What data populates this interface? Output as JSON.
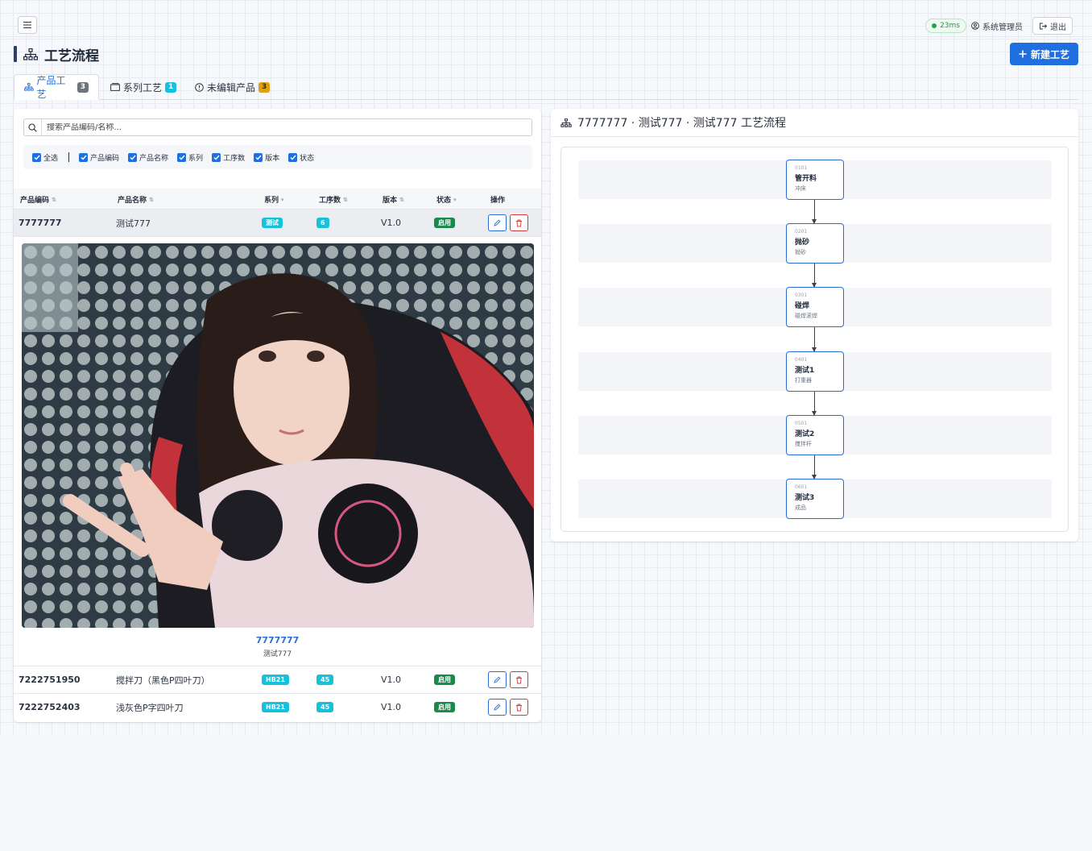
{
  "header": {
    "latency": "23ms",
    "user": "系统管理员",
    "logout": "退出"
  },
  "page": {
    "title": "工艺流程",
    "new_button": "新建工艺"
  },
  "tabs": [
    {
      "label": "产品工艺",
      "count": "3",
      "active": true
    },
    {
      "label": "系列工艺",
      "count": "1",
      "active": false
    },
    {
      "label": "未编辑产品",
      "count": "3",
      "active": false
    }
  ],
  "search": {
    "placeholder": "搜索产品编码/名称..."
  },
  "filters": [
    "全选",
    "产品编码",
    "产品名称",
    "系列",
    "工序数",
    "版本",
    "状态"
  ],
  "table": {
    "headers": [
      "产品编码",
      "产品名称",
      "系列",
      "工序数",
      "版本",
      "状态",
      "操作"
    ],
    "rows": [
      {
        "code": "7777777",
        "name": "测试777",
        "series": "测试",
        "steps": "6",
        "version": "V1.0",
        "status": "启用"
      },
      {
        "code": "7222751950",
        "name": "搅拌刀（黑色P四叶刀）",
        "series": "HB21",
        "steps": "45",
        "version": "V1.0",
        "status": "启用"
      },
      {
        "code": "7222752403",
        "name": "浅灰色P字四叶刀",
        "series": "HB21",
        "steps": "45",
        "version": "V1.0",
        "status": "启用"
      }
    ]
  },
  "detail": {
    "code": "7777777",
    "name": "测试777"
  },
  "flow": {
    "title": "7777777 · 测试777 · 测试777 工艺流程",
    "nodes": [
      {
        "code": "0101",
        "name": "管开料",
        "desc": "冲床"
      },
      {
        "code": "0201",
        "name": "抛砂",
        "desc": "抛砂"
      },
      {
        "code": "0301",
        "name": "碰焊",
        "desc": "碰焊滚焊"
      },
      {
        "code": "0401",
        "name": "测试1",
        "desc": "打重器"
      },
      {
        "code": "0501",
        "name": "测试2",
        "desc": "搅拌杆"
      },
      {
        "code": "0601",
        "name": "测试3",
        "desc": "成品"
      }
    ]
  },
  "colors": {
    "accent": "#1f6fe0",
    "success": "#1a8a4c",
    "info": "#16c1dd",
    "danger": "#d33b3b"
  }
}
